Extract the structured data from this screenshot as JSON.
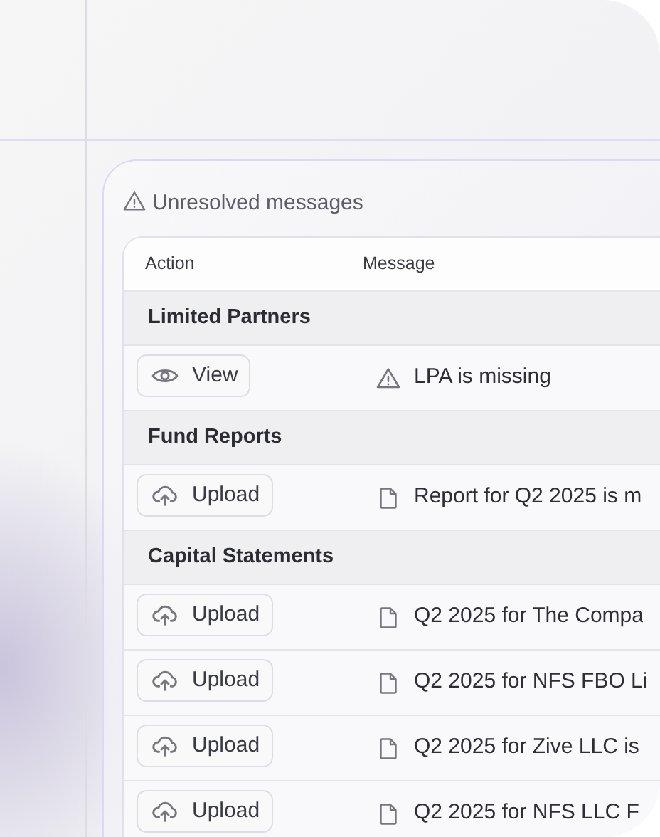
{
  "panel": {
    "title": "Unresolved messages"
  },
  "table": {
    "columns": [
      "Action",
      "Message"
    ],
    "groups": [
      {
        "name": "Limited Partners",
        "rows": [
          {
            "action": {
              "kind": "view",
              "label": "View"
            },
            "message": {
              "kind": "warning",
              "text": "LPA is missing"
            }
          }
        ]
      },
      {
        "name": "Fund Reports",
        "rows": [
          {
            "action": {
              "kind": "upload",
              "label": "Upload"
            },
            "message": {
              "kind": "document",
              "text": "Report for Q2 2025 is m"
            }
          }
        ]
      },
      {
        "name": "Capital Statements",
        "rows": [
          {
            "action": {
              "kind": "upload",
              "label": "Upload"
            },
            "message": {
              "kind": "document",
              "text": "Q2 2025 for The Compa"
            }
          },
          {
            "action": {
              "kind": "upload",
              "label": "Upload"
            },
            "message": {
              "kind": "document",
              "text": "Q2 2025 for NFS FBO Li"
            }
          },
          {
            "action": {
              "kind": "upload",
              "label": "Upload"
            },
            "message": {
              "kind": "document",
              "text": "Q2 2025 for Zive LLC is"
            }
          },
          {
            "action": {
              "kind": "upload",
              "label": "Upload"
            },
            "message": {
              "kind": "document",
              "text": "Q2 2025 for NFS LLC F"
            }
          }
        ]
      }
    ]
  }
}
